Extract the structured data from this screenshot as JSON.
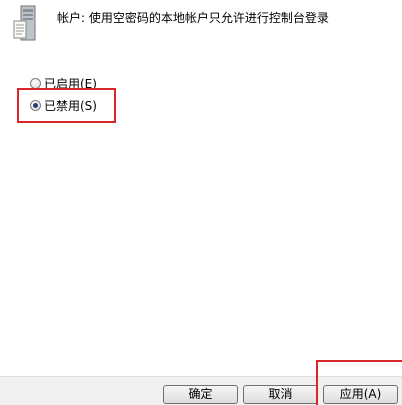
{
  "header": {
    "icon": "server-policy-icon",
    "title": "帐户: 使用空密码的本地帐户只允许进行控制台登录"
  },
  "options": {
    "enabled_label": "已启用(E)",
    "disabled_label": "已禁用(S)",
    "selected": "disabled"
  },
  "buttons": {
    "ok": "确定",
    "cancel": "取消",
    "apply": "应用(A)"
  },
  "colors": {
    "highlight": "#d9262b",
    "radio_dot": "#1d3f7a"
  }
}
